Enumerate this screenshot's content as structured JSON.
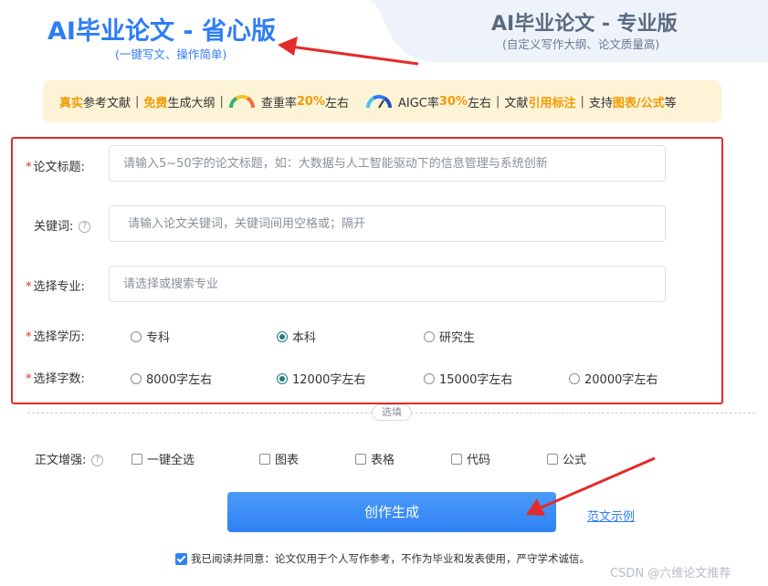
{
  "tabs": {
    "basic": {
      "title": "AI毕业论文 - 省心版",
      "subtitle": "(一键写文、操作简单)"
    },
    "pro": {
      "title": "AI毕业论文 - 专业版",
      "subtitle": "(自定义写作大纲、论文质量高)"
    }
  },
  "banner": {
    "p1_hl": "真实",
    "p1": "参考文献",
    "p2_hl": "免费",
    "p2": "生成大纲",
    "p3_a": "查重率",
    "p3_hl": "20%",
    "p3_b": "左右",
    "p4_a": "AIGC率",
    "p4_hl": "30%",
    "p4_b": " 左右",
    "p5_a": "文献",
    "p5_hl": "引用标注",
    "p6_a": "支持",
    "p6_hl": "图表/公式",
    "p6_b": "等",
    "sep": "|"
  },
  "form": {
    "required_mark": "*",
    "title_label": "论文标题:",
    "title_placeholder": "请输入5~50字的论文标题，如：大数据与人工智能驱动下的信息管理与系统创新",
    "keywords_label": "关键词:",
    "keywords_help": "?",
    "keywords_placeholder": "请输入论文关键词，关键词间用空格或；隔开",
    "major_label": "选择专业:",
    "major_placeholder": "请选择或搜索专业",
    "degree_label": "选择学历:",
    "degree_options": [
      "专科",
      "本科",
      "研究生"
    ],
    "degree_selected": "本科",
    "words_label": "选择字数:",
    "words_options": [
      "8000字左右",
      "12000字左右",
      "15000字左右",
      "20000字左右"
    ],
    "words_selected": "12000字左右"
  },
  "optional_label": "选填",
  "enhance": {
    "label": "正文增强:",
    "help": "?",
    "options": [
      "一键全选",
      "图表",
      "表格",
      "代码",
      "公式"
    ]
  },
  "generate_label": "创作生成",
  "sample_link": "范文示例",
  "agreement": "我已阅读并同意：论文仅用于个人写作参考，不作为毕业和发表使用，严守学术诚信。",
  "watermark": "CSDN @六维论文推荐",
  "colors": {
    "accent": "#2f7df6",
    "highlight": "#f39a00",
    "annotation_red": "#e32b2b",
    "radio_checked": "#1e7d7b"
  }
}
